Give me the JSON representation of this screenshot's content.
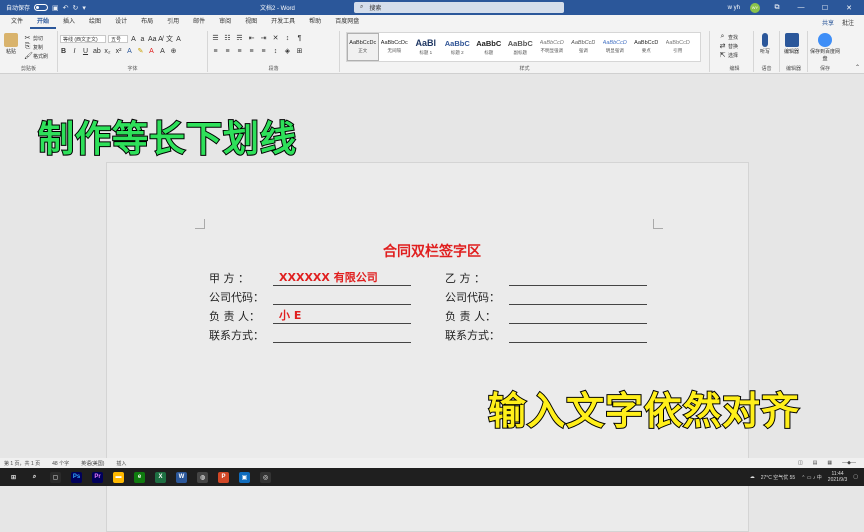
{
  "titlebar": {
    "autosave": "自动保存",
    "doc_title": "文档2 - Word",
    "search_placeholder": "搜索",
    "user": "w yh",
    "avatar": "WY"
  },
  "tabs": [
    "文件",
    "开始",
    "插入",
    "绘图",
    "设计",
    "布局",
    "引用",
    "邮件",
    "审阅",
    "视图",
    "开发工具",
    "帮助",
    "百度网盘"
  ],
  "active_tab": "开始",
  "tab_right": {
    "share": "共享",
    "comments": "批注"
  },
  "ribbon": {
    "clipboard": {
      "paste": "粘贴",
      "cut": "剪切",
      "copy": "复制",
      "format_painter": "格式刷",
      "label": "剪贴板"
    },
    "font": {
      "font_name": "等线 (西文正文)",
      "font_size": "五号",
      "label": "字体"
    },
    "paragraph": {
      "label": "段落"
    },
    "styles": {
      "label": "样式",
      "items": [
        {
          "sample": "AaBbCcDc",
          "name": "正文"
        },
        {
          "sample": "AaBbCcDc",
          "name": "无间隔"
        },
        {
          "sample": "AaBl",
          "name": "标题 1"
        },
        {
          "sample": "AaBbC",
          "name": "标题 2"
        },
        {
          "sample": "AaBbC",
          "name": "标题"
        },
        {
          "sample": "AaBbC",
          "name": "副标题"
        },
        {
          "sample": "AaBbCcD",
          "name": "不明显强调"
        },
        {
          "sample": "AaBbCcD",
          "name": "强调"
        },
        {
          "sample": "AaBbCcD",
          "name": "明显强调"
        },
        {
          "sample": "AaBbCcD",
          "name": "要点"
        },
        {
          "sample": "AaBbCcD",
          "name": "引用"
        }
      ]
    },
    "editing": {
      "find": "查找",
      "replace": "替换",
      "select": "选择",
      "label": "编辑"
    },
    "voice": {
      "dictate": "听写",
      "label": "语音"
    },
    "editor": {
      "editor": "编辑器",
      "label": "编辑器"
    },
    "save": {
      "save_baidu": "保存到百度网盘",
      "label": "保存"
    }
  },
  "document": {
    "title": "合同双栏签字区",
    "left": [
      {
        "label": "甲  方  ：",
        "value": "XXXXXX 有限公司"
      },
      {
        "label": "公司代码：",
        "value": ""
      },
      {
        "label": "负 责 人：",
        "value": "小 E"
      },
      {
        "label": "联系方式：",
        "value": ""
      }
    ],
    "right": [
      {
        "label": "乙  方  ：",
        "value": ""
      },
      {
        "label": "公司代码：",
        "value": ""
      },
      {
        "label": "负 责 人：",
        "value": ""
      },
      {
        "label": "联系方式：",
        "value": ""
      }
    ]
  },
  "overlay": {
    "top": "制作等长下划线",
    "bottom": "输入文字依然对齐"
  },
  "statusbar": {
    "page": "第 1 页，共 1 页",
    "words": "48 个字",
    "lang": "英语(美国)",
    "mode": "插入"
  },
  "taskbar": {
    "weather": "27°C  空气优 55",
    "time": "11:44",
    "date": "2021/9/3"
  },
  "colors": {
    "accent": "#2b579a",
    "red_text": "#e01e1e",
    "overlay_green": "#2ee05a",
    "overlay_yellow": "#ffef1a"
  }
}
